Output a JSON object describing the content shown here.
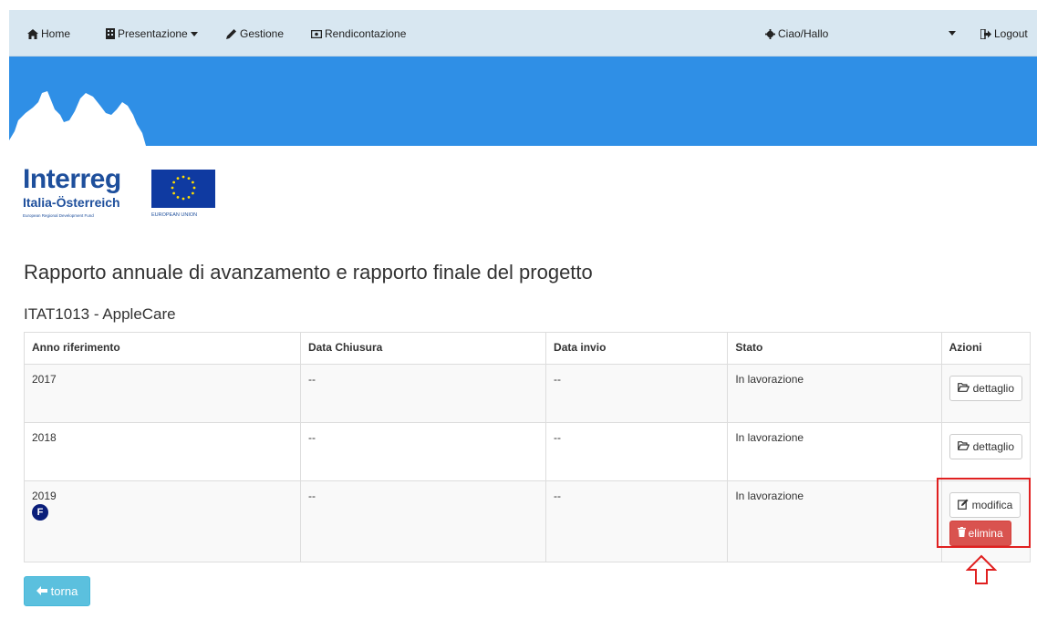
{
  "navbar": {
    "home": "Home",
    "presentazione": "Presentazione",
    "gestione": "Gestione",
    "rendicontazione": "Rendicontazione",
    "user": "Ciao/Hallo",
    "logout": "Logout"
  },
  "logo": {
    "title": "Interreg",
    "subtitle": "Italia-Österreich",
    "fund": "European Regional Development Fund",
    "eu_label": "EUROPEAN UNION"
  },
  "page": {
    "title": "Rapporto annuale di avanzamento e rapporto finale del progetto",
    "project": "ITAT1013 - AppleCare"
  },
  "table": {
    "headers": [
      "Anno riferimento",
      "Data Chiusura",
      "Data invio",
      "Stato",
      "Azioni"
    ],
    "rows": [
      {
        "anno": "2017",
        "chiusura": "--",
        "invio": "--",
        "stato": "In lavorazione",
        "action": "dettaglio"
      },
      {
        "anno": "2018",
        "chiusura": "--",
        "invio": "--",
        "stato": "In lavorazione",
        "action": "dettaglio"
      },
      {
        "anno": "2019",
        "badge": "F",
        "chiusura": "--",
        "invio": "--",
        "stato": "In lavorazione",
        "action": "modifica",
        "action2": "elimina"
      }
    ]
  },
  "back_button": "torna",
  "colors": {
    "navbar_bg": "#d8e7f1",
    "banner_blue": "#2f8fe6",
    "danger": "#d9534f",
    "info": "#5bc0de",
    "highlight": "#e02020",
    "badge": "#0a1e7a"
  }
}
